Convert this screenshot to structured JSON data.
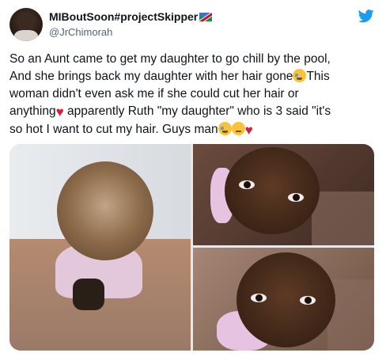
{
  "user": {
    "name": "MIBoutSoon#projectSkipper",
    "handle": "@JrChimorah"
  },
  "tweet": {
    "lines": [
      "So an Aunt came to get my daughter to go chill by the pool,",
      "And she brings back my daughter with her hair gone",
      "This",
      "woman didn't even ask me if she could cut her hair or",
      "anything",
      " apparently Ruth \"my daughter\" who is 3 said \"it's",
      "so hot I want to cut my hair. Guys man"
    ]
  },
  "icons": {
    "brand": "twitter-bird-icon",
    "flag": "namibia-flag-icon",
    "emoji_crying": "loudly-crying-face-icon",
    "emoji_sad": "sad-relieved-face-icon",
    "emoji_broken_heart": "broken-heart-icon"
  },
  "colors": {
    "brand_blue": "#1d9bf0",
    "text": "#0f1419",
    "secondary_text": "#536471",
    "heart_red": "#d0213d"
  },
  "media": {
    "photo_count": 3
  }
}
